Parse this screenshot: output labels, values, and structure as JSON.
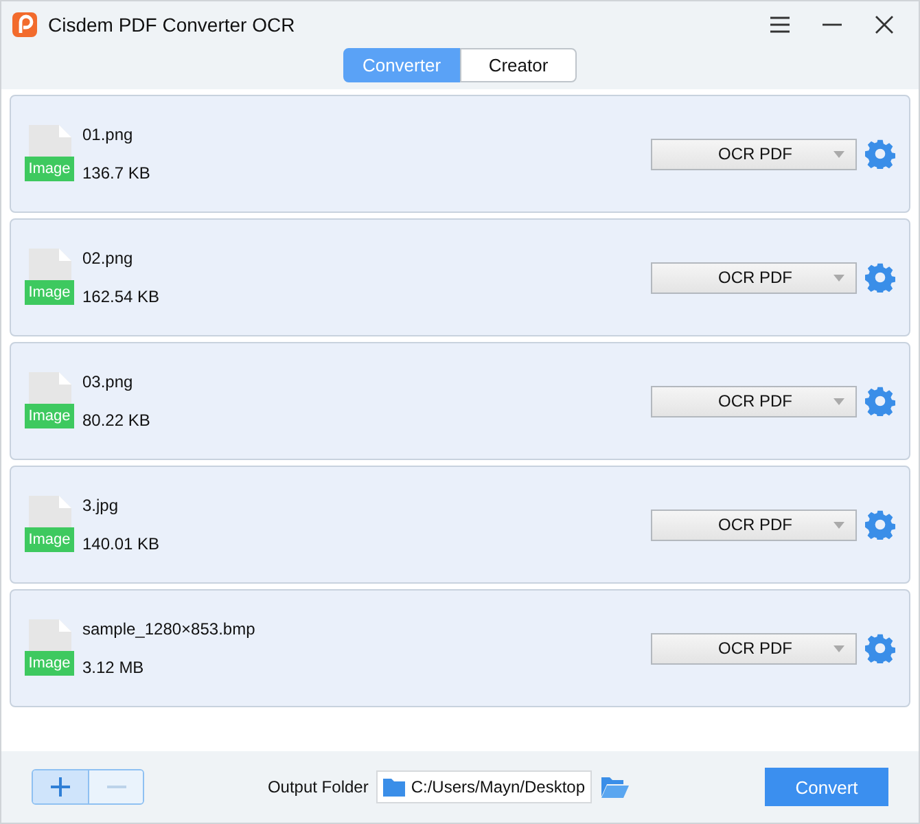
{
  "window": {
    "title": "Cisdem PDF Converter OCR"
  },
  "tabs": [
    {
      "label": "Converter",
      "selected": true
    },
    {
      "label": "Creator",
      "selected": false
    }
  ],
  "files": [
    {
      "badge": "Image",
      "name": "01.png",
      "size": "136.7 KB",
      "format": "OCR PDF"
    },
    {
      "badge": "Image",
      "name": "02.png",
      "size": "162.54 KB",
      "format": "OCR PDF"
    },
    {
      "badge": "Image",
      "name": "03.png",
      "size": "80.22 KB",
      "format": "OCR PDF"
    },
    {
      "badge": "Image",
      "name": "3.jpg",
      "size": "140.01 KB",
      "format": "OCR PDF"
    },
    {
      "badge": "Image",
      "name": "sample_1280×853.bmp",
      "size": "3.12 MB",
      "format": "OCR PDF"
    }
  ],
  "footer": {
    "add_disabled": false,
    "remove_disabled": true,
    "output_label": "Output Folder",
    "output_path": "C:/Users/Mayn/Desktop",
    "convert": "Convert"
  }
}
